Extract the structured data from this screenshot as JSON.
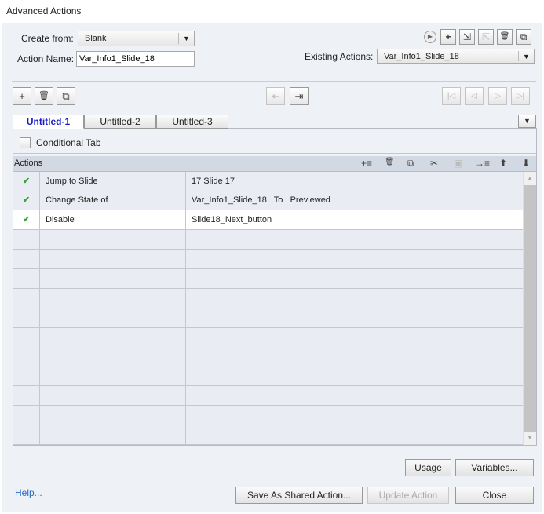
{
  "window": {
    "title": "Advanced Actions"
  },
  "form": {
    "create_from_label": "Create from:",
    "create_from_value": "Blank",
    "action_name_label": "Action Name:",
    "action_name_value": "Var_Info1_Slide_18",
    "existing_label": "Existing Actions:",
    "existing_value": "Var_Info1_Slide_18"
  },
  "tabs": [
    {
      "label": "Untitled-1",
      "active": true
    },
    {
      "label": "Untitled-2"
    },
    {
      "label": "Untitled-3"
    }
  ],
  "conditional": {
    "label": "Conditional Tab",
    "checked": false
  },
  "actions": {
    "header": "Actions",
    "rows": [
      {
        "status": "✔",
        "action": "Jump to Slide",
        "target": "17 Slide 17"
      },
      {
        "status": "✔",
        "action": "Change State of",
        "target": "Var_Info1_Slide_18   To   Previewed"
      },
      {
        "status": "✔",
        "action": "Disable",
        "target": "Slide18_Next_button",
        "selected": true
      }
    ],
    "empty_rows": 11
  },
  "buttons": {
    "usage": "Usage",
    "variables": "Variables...",
    "help": "Help...",
    "save_shared": "Save As Shared Action...",
    "update": "Update Action",
    "close": "Close"
  },
  "icons": {
    "dropdown": "▼",
    "play": "▶",
    "plus": "+",
    "trash": "🗑",
    "copy": "⧉",
    "first": "|◁",
    "prev": "◁",
    "next": "▷",
    "last": "▷|",
    "up": "🡅",
    "down": "🡇",
    "scroll_up": "▲",
    "scroll_down": "▼"
  }
}
